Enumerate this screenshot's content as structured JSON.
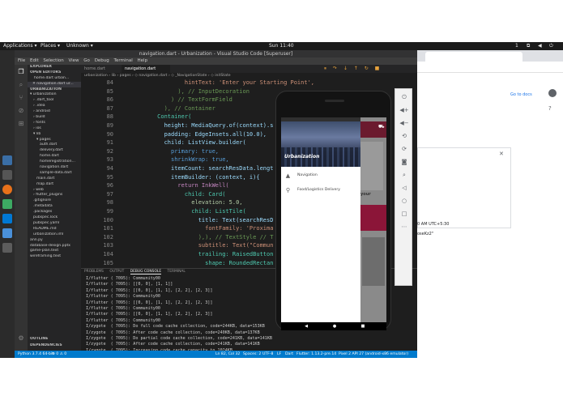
{
  "topbar": {
    "applications": "Applications ▾",
    "places": "Places ▾",
    "unknown": "Unknown ▾",
    "clock": "Sun 11:40",
    "keyboard": "1"
  },
  "vscode": {
    "title": "navigation.dart - Urbanization - Visual Studio Code [Superuser]",
    "menu": [
      "File",
      "Edit",
      "Selection",
      "View",
      "Go",
      "Debug",
      "Terminal",
      "Help"
    ],
    "explorer": {
      "header": "EXPLORER",
      "open_editors": "OPEN EDITORS",
      "open_files": [
        "home.dart  urban...",
        "✕ navigation.dart  ur..."
      ],
      "project": "URBANIZATION",
      "tree": [
        "▾ urbanization",
        "› .dart_tool",
        "› .idea",
        "› android",
        "› build",
        "› fonts",
        "› ios",
        "▾ lib",
        "▾ pages",
        "auth.dart",
        "delivery.dart",
        "home.dart",
        "homeregistration...",
        "navigation.dart",
        "sample-data.dart",
        "main.dart",
        "map.dart",
        "› web",
        "› flutter_plugins",
        ".gitignore",
        ".metadata",
        ".packages",
        "pubspec.lock",
        "pubspec.yaml",
        "README.md",
        "urbanization.iml",
        "ann.py",
        "database-design.pptx",
        "game-plan.text",
        "wireframing.text"
      ],
      "outline": "OUTLINE",
      "dependencies": "DEPENDENCIES"
    },
    "tabs": [
      "home.dart",
      "navigation.dart"
    ],
    "breadcrumb": "urbanization › lib › pages › ◇ navigation.dart › ◇ _NavigationState › ◇ initState",
    "line_numbers": [
      "84",
      "85",
      "86",
      "87",
      "88",
      "89",
      "90",
      "91",
      "92",
      "93",
      "94",
      "95",
      "96",
      "97",
      "98",
      "99",
      "100",
      "101",
      "102",
      "103",
      "104",
      "105"
    ],
    "code_lines": [
      "                  hintText: 'Enter your Starting Point',",
      "                ), // InputDecoration",
      "              ) // TextFormField",
      "            ), // Container",
      "          Container(",
      "            height: MediaQuery.of(context).s",
      "            padding: EdgeInsets.all(10.0),",
      "            child: ListView.builder(",
      "              primary: true,",
      "              shrinkWrap: true,",
      "              itemCount: searchResData.lengt",
      "              itemBuilder: (context, i){",
      "                return InkWell(",
      "                  child: Card(",
      "                    elevation: 5.0,",
      "                    child: ListTile(",
      "                      title: Text(searchResD",
      "                        fontFamily: 'Proxima",
      "                      ),), // TextStyle // T",
      "                      subtitle: Text(\"Commun",
      "                      trailing: RaisedButton",
      "                        shape: RoundedRectan"
    ],
    "panel_tabs": [
      "PROBLEMS",
      "OUTPUT",
      "DEBUG CONSOLE",
      "TERMINAL"
    ],
    "terminal_lines": [
      "I/flutter ( 7095): Community00",
      "I/flutter ( 7095): [[0, 0], [1, 1]]",
      "I/flutter ( 7095): [[0, 0], [1, 1], [2, 2], [2, 3]]",
      "I/flutter ( 7095): Community00",
      "I/flutter ( 7095): [[0, 0], [1, 1], [2, 2], [2, 3]]",
      "I/flutter ( 7095): Community00",
      "I/flutter ( 7095): [[0, 0], [1, 1], [2, 2], [2, 3]]",
      "I/flutter ( 7095): Community00",
      "I/zygote  ( 7095): Do full code cache collection, code=244KB, data=153KB",
      "I/zygote  ( 7095): After code cache collection, code=240KB, data=137KB",
      "I/zygote  ( 7095): Do partial code cache collection, code=241KB, data=141KB",
      "I/zygote  ( 7095): After code cache collection, code=241KB, data=141KB",
      "I/zygote  ( 7095): Increasing code cache capacity to 1024KB"
    ],
    "status": {
      "python": "Python 3.7.4 64-bit",
      "problems": "⊗ 0 ⚠ 0",
      "cursor": "Ln 82, Col 32",
      "spaces": "Spaces: 2",
      "encoding": "UTF-8",
      "eol": "LF",
      "language": "Dart",
      "flutter": "Flutter: 1.13.2-pre.14",
      "device": "Pixel 2 API 27 (android-x86 emulator)"
    }
  },
  "browser": {
    "go_to_docs": "Go to docs",
    "snippets": [
      "0 AM UTC+5:30",
      "oseKz2\""
    ],
    "close": "✕"
  },
  "phone": {
    "brand": "Urbanization",
    "drawer_items": [
      {
        "icon": "navigation-icon",
        "glyph": "▲",
        "label": "Navigation"
      },
      {
        "icon": "bike-icon",
        "glyph": "⚲",
        "label": "Food/Logistics Delivery"
      }
    ],
    "behind_text": "your"
  }
}
